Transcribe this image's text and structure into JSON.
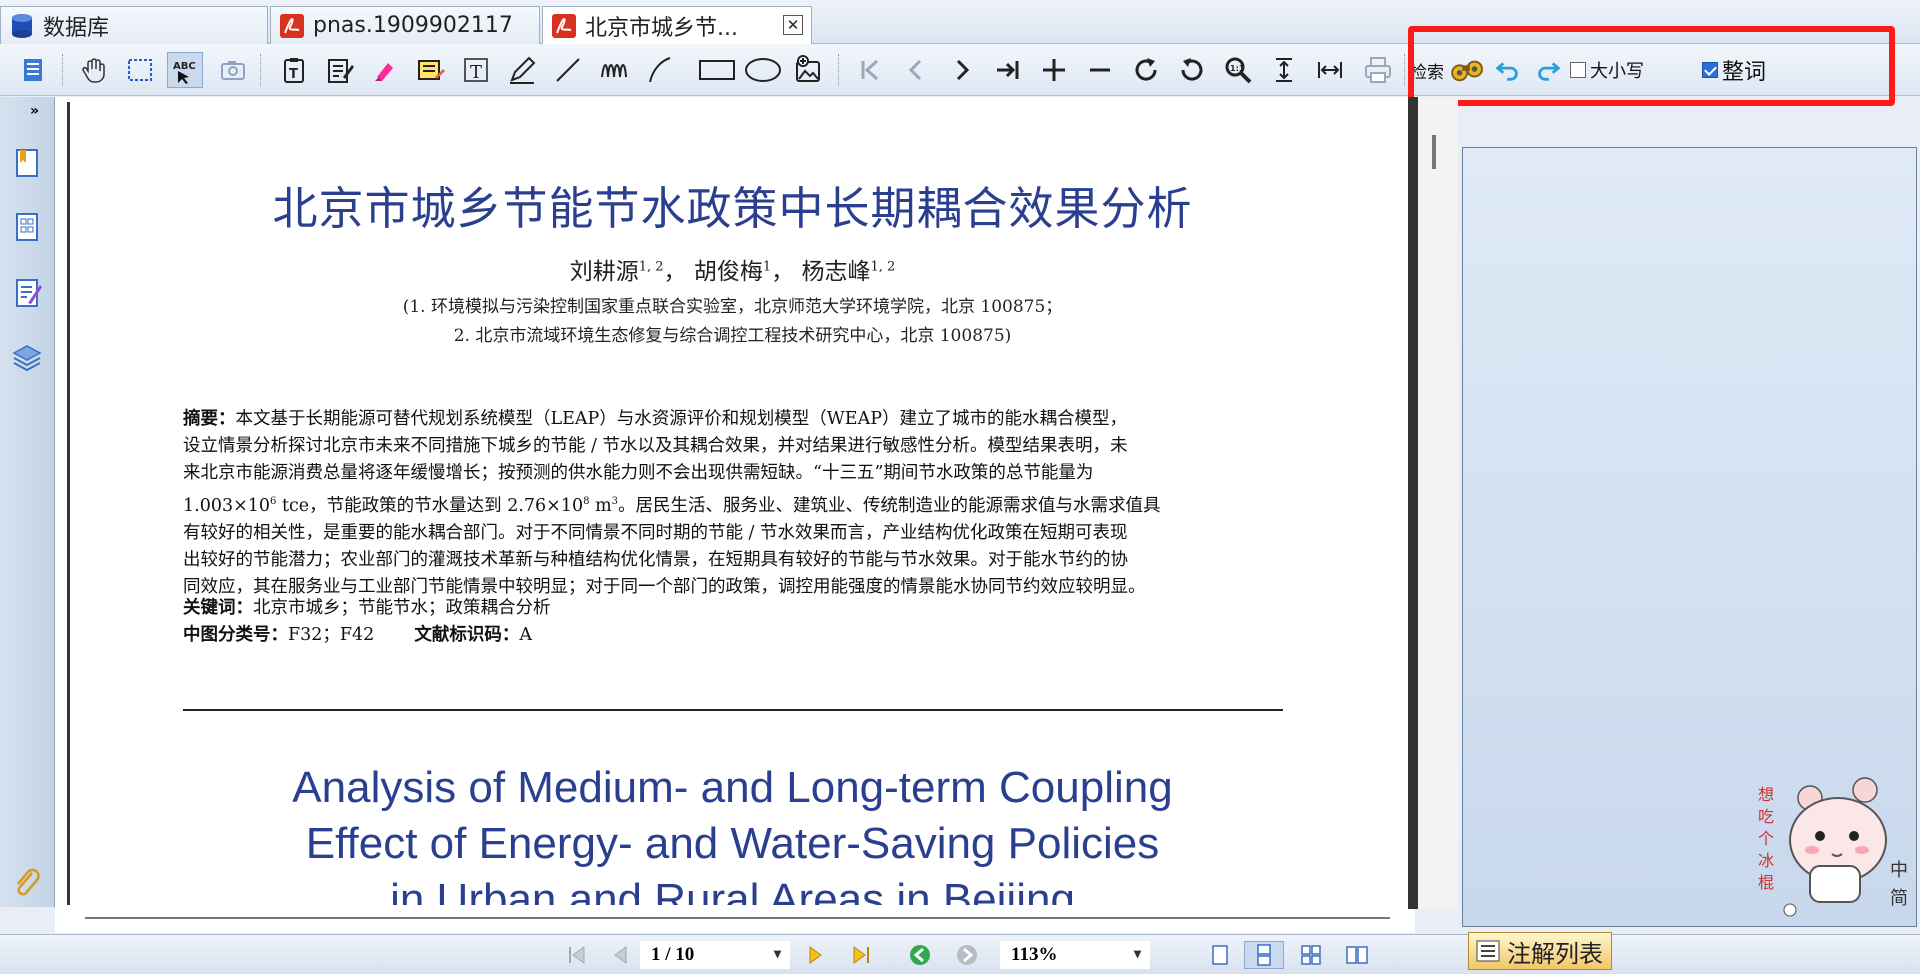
{
  "tabs": [
    {
      "label": "数据库",
      "icon": "database-icon"
    },
    {
      "label": "pnas.1909902117",
      "icon": "pdf-icon"
    },
    {
      "label": "北京市城乡节...",
      "icon": "pdf-icon",
      "active": true
    }
  ],
  "search": {
    "label": "检索",
    "case_label": "大小写",
    "case_checked": false,
    "whole_word_label": "整词",
    "whole_word_checked": true
  },
  "document": {
    "title_cn": "北京市城乡节能节水政策中长期耦合效果分析",
    "authors": "刘耕源 1,2，胡俊梅 1，杨志峰 1,2",
    "author1": "刘耕源",
    "author1_sup": "1, 2",
    "author2": "胡俊梅",
    "author2_sup": "1",
    "author3": "杨志峰",
    "author3_sup": "1, 2",
    "affiliation1": "(1. 环境模拟与污染控制国家重点联合实验室，北京师范大学环境学院，北京 100875；",
    "affiliation2": "2. 北京市流域环境生态修复与综合调控工程技术研究中心，北京 100875)",
    "abstract_label": "摘要：",
    "abstract_l1": "本文基于长期能源可替代规划系统模型（LEAP）与水资源评价和规划模型（WEAP）建立了城市的能水耦合模型，",
    "abstract_l2": "设立情景分析探讨北京市未来不同措施下城乡的节能 / 节水以及其耦合效果，并对结果进行敏感性分析。模型结果表明，未",
    "abstract_l3": "来北京市能源消费总量将逐年缓慢增长；按预测的供水能力则不会出现供需短缺。“十三五”期间节水政策的总节能量为",
    "abstract_l4a": "1.003×10",
    "abstract_l4_sup1": "6",
    "abstract_l4b": " tce，节能政策的节水量达到 2.76×10",
    "abstract_l4_sup2": "8",
    "abstract_l4c": " m",
    "abstract_l4_sup3": "3",
    "abstract_l4d": "。居民生活、服务业、建筑业、传统制造业的能源需求值与水需求值具",
    "abstract_l5": "有较好的相关性，是重要的能水耦合部门。对于不同情景不同时期的节能 / 节水效果而言，产业结构优化政策在短期可表现",
    "abstract_l6": "出较好的节能潜力；农业部门的灌溉技术革新与种植结构优化情景，在短期具有较好的节能与节水效果。对于能水节约的协",
    "abstract_l7": "同效应，其在服务业与工业部门节能情景中较明显；对于同一个部门的政策，调控用能强度的情景能水协同节约效应较明显。",
    "keywords_label": "关键词：",
    "keywords": "北京市城乡；节能节水；政策耦合分析",
    "class_label": "中图分类号：",
    "class_value": "F32；F42",
    "doc_code_label": "文献标识码：",
    "doc_code_value": "A",
    "title_en_1": "Analysis of Medium- and Long-term Coupling",
    "title_en_2": "Effect of Energy- and Water-Saving Policies",
    "title_en_3": "in Urban and Rural Areas in Beijing"
  },
  "status": {
    "page": "1 / 10",
    "zoom": "113%"
  },
  "notes_tab": "注解列表",
  "colors": {
    "accent": "#2a3f8f",
    "highlight_box": "#ff1a1a"
  }
}
